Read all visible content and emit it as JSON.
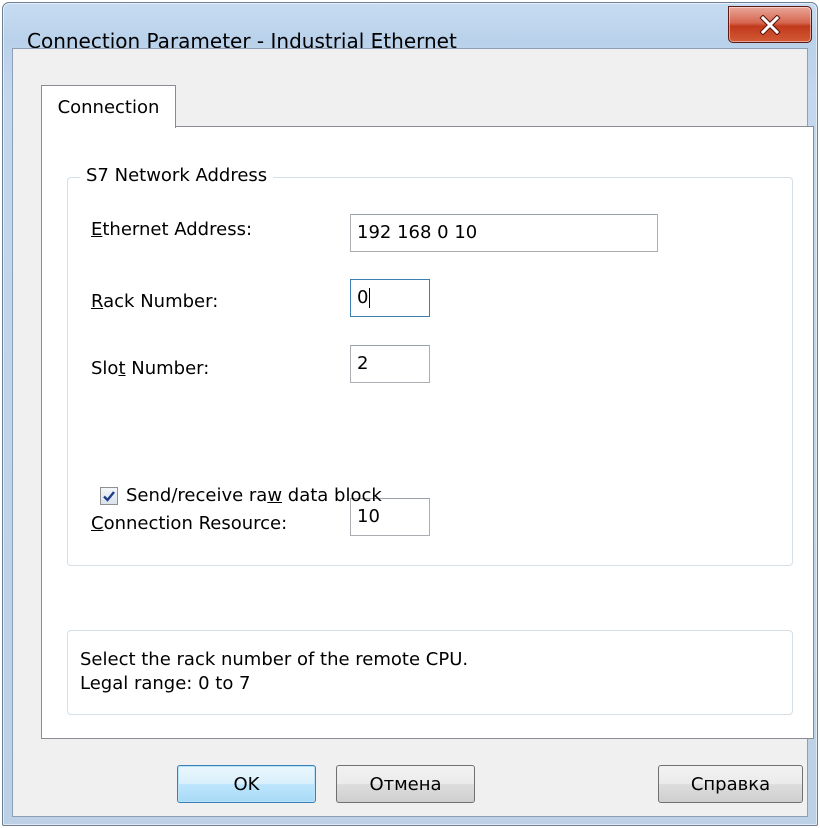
{
  "window": {
    "title": "Connection Parameter - Industrial Ethernet",
    "close_icon": "close-x-icon"
  },
  "tabs": [
    {
      "label": "Connection",
      "selected": true
    }
  ],
  "group": {
    "legend": "S7 Network Address"
  },
  "fields": {
    "ethernet_address": {
      "label_pre": "",
      "label_mnemonic": "E",
      "label_post": "thernet Address:",
      "value": "192 168 0 10"
    },
    "rack_number": {
      "label_pre": "",
      "label_mnemonic": "R",
      "label_post": "ack Number:",
      "value": "0"
    },
    "slot_number": {
      "label_pre": "Slo",
      "label_mnemonic": "t",
      "label_post": " Number:",
      "value": "2"
    },
    "connection_resource": {
      "label_pre": "",
      "label_mnemonic": "C",
      "label_post": "onnection Resource:",
      "value": "10"
    }
  },
  "checkbox": {
    "label_pre": "Send/receive ra",
    "label_mnemonic": "w",
    "label_post": " data block",
    "checked": true
  },
  "hint": {
    "line1": "Select the rack number of the remote CPU.",
    "line2": "Legal range: 0 to 7"
  },
  "buttons": {
    "ok": "OK",
    "cancel": "Отмена",
    "help": "Справка"
  },
  "colors": {
    "default_button_border": "#3c7fb1",
    "close_button": "#c13a1c"
  }
}
